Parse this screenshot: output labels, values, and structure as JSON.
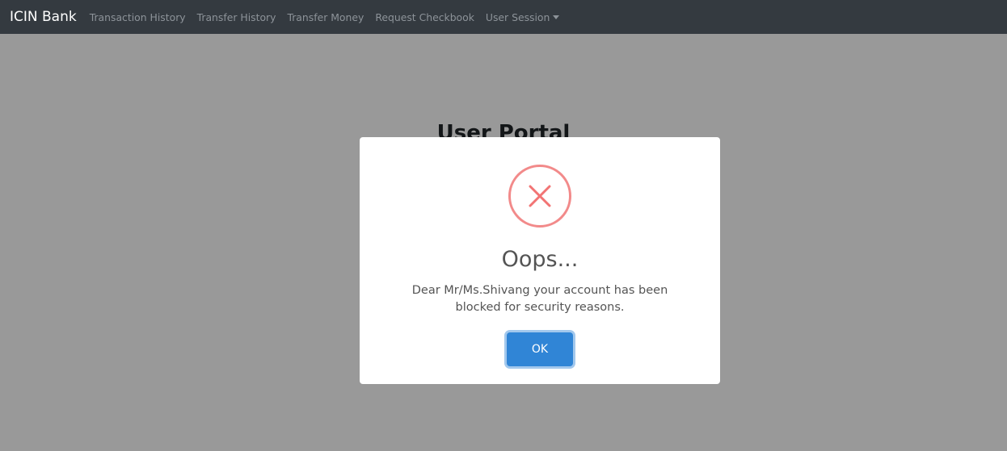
{
  "navbar": {
    "brand": "ICIN Bank",
    "items": [
      {
        "label": "Transaction History"
      },
      {
        "label": "Transfer History"
      },
      {
        "label": "Transfer Money"
      },
      {
        "label": "Request Checkbook"
      }
    ],
    "dropdown": {
      "label": "User Session"
    }
  },
  "page": {
    "title": "User Portal"
  },
  "modal": {
    "icon": "error-x-icon",
    "title": "Oops...",
    "message": "Dear Mr/Ms.Shivang your account has been blocked for security reasons.",
    "ok_label": "OK"
  },
  "colors": {
    "navbar_bg": "#343a40",
    "error_icon": "#f27474",
    "confirm_button": "#3085d6"
  }
}
